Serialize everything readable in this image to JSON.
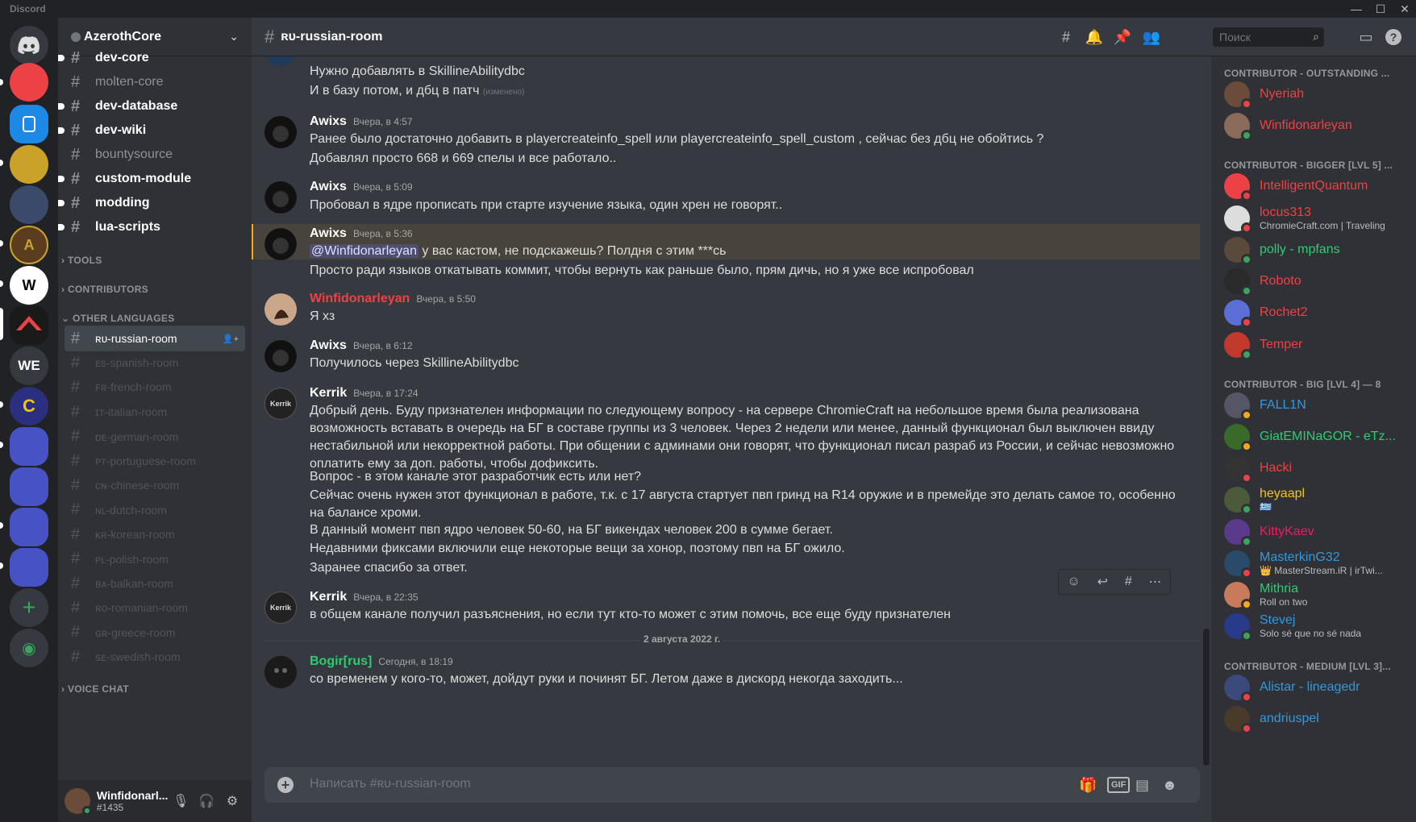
{
  "window": {
    "title": "Discord"
  },
  "guild": {
    "name": "AzerothCore"
  },
  "channel_list": [
    {
      "name": "dev-core",
      "state": "bright",
      "unread": true
    },
    {
      "name": "molten-core",
      "state": "mid",
      "unread": false
    },
    {
      "name": "dev-database",
      "state": "bright",
      "unread": true
    },
    {
      "name": "dev-wiki",
      "state": "bright",
      "unread": true
    },
    {
      "name": "bountysource",
      "state": "mid",
      "unread": false
    },
    {
      "name": "custom-module",
      "state": "bright",
      "unread": true
    },
    {
      "name": "modding",
      "state": "bright",
      "unread": true
    },
    {
      "name": "lua-scripts",
      "state": "bright",
      "unread": true
    }
  ],
  "categories": {
    "tools": "TOOLS",
    "contributors": "CONTRIBUTORS",
    "other_languages": "OTHER LANGUAGES",
    "voice_chat": "VOICE CHAT"
  },
  "language_channels": [
    {
      "name": "ʀᴜ-russian-room",
      "active": true
    },
    {
      "name": "ᴇs-spanish-room"
    },
    {
      "name": "ꜰʀ-french-room"
    },
    {
      "name": "ɪᴛ-italian-room"
    },
    {
      "name": "ᴅᴇ-german-room"
    },
    {
      "name": "ᴘᴛ-portuguese-room"
    },
    {
      "name": "ᴄɴ-chinese-room"
    },
    {
      "name": "ɴʟ-dutch-room"
    },
    {
      "name": "ᴋʀ-korean-room"
    },
    {
      "name": "ᴘʟ-polish-room"
    },
    {
      "name": "ʙᴀ-balkan-room"
    },
    {
      "name": "ʀᴏ-romanian-room"
    },
    {
      "name": "ɢʀ-greece-room"
    },
    {
      "name": "sᴇ-swedish-room"
    }
  ],
  "user": {
    "name": "Winfidonarl...",
    "tag": "#1435"
  },
  "header": {
    "channel": "ʀᴜ-russian-room",
    "search_placeholder": "Поиск"
  },
  "servers": [
    {
      "label": "",
      "color": "#ed4245"
    },
    {
      "label": "",
      "color": "#1e88e5"
    },
    {
      "label": "",
      "color": "#c9a227"
    },
    {
      "label": "",
      "color": "#3b4a6b"
    },
    {
      "label": "",
      "color": "#5a3d1e"
    },
    {
      "label": "W",
      "color": "#ffffff"
    },
    {
      "label": "",
      "color": "#1a1a1a"
    },
    {
      "label": "WE",
      "color": "#36393f"
    },
    {
      "label": "",
      "color": "#2a2f80"
    },
    {
      "label": "",
      "color": "#4752c4"
    },
    {
      "label": "",
      "color": "#4752c4"
    },
    {
      "label": "",
      "color": "#4752c4"
    },
    {
      "label": "",
      "color": "#4752c4"
    }
  ],
  "messages": {
    "m0": {
      "line1": "Нужно добавлять в SkillineAbilitydbc",
      "line2": "И в базу потом, и дбц в патч",
      "edited": "(изменено)"
    },
    "m1": {
      "author": "Awixs",
      "time": "Вчера, в 4:57",
      "line1": "Ранее было достаточно добавить в playercreateinfo_spell или playercreateinfo_spell_custom , сейчас без дбц не обойтись ?",
      "line2": "Добавлял просто 668 и 669 спелы и все работало.."
    },
    "m2": {
      "author": "Awixs",
      "time": "Вчера, в 5:09",
      "line1": "Пробовал в ядре прописать при старте изучение языка, один хрен не говорят.."
    },
    "m3": {
      "author": "Awixs",
      "time": "Вчера, в 5:36",
      "mention": "@Winfidonarleyan",
      "line1": " у вас кастом, не подскажешь? Полдня с этим ***сь",
      "line2": "Просто ради языков откатывать коммит, чтобы вернуть как раньше было, прям дичь, но я уже все испробовал"
    },
    "m4": {
      "author": "Winfidonarleyan",
      "time": "Вчера, в 5:50",
      "line1": "Я хз"
    },
    "m5": {
      "author": "Awixs",
      "time": "Вчера, в 6:12",
      "line1": "Получилось через SkillineAbilitydbc"
    },
    "m6": {
      "author": "Kerrik",
      "time": "Вчера, в 17:24",
      "p1": "Добрый день. Буду признателен информации по следующему вопросу - на сервере ChromieCraft на небольшое время была реализована возможность вставать в очередь на БГ в составе группы из 3 человек. Через 2 недели или менее, данный функционал был выключен ввиду нестабильной или некорректной работы.  При общении с админами они говорят, что функционал писал разраб из России, и сейчас невозможно оплатить ему за доп. работы, чтобы дофиксить.",
      "p2": "Вопрос - в этом канале этот разработчик есть или нет?",
      "p3": "Сейчас очень нужен этот функционал в работе, т.к. с 17 августа стартует пвп гринд на R14 оружие и в премейде это делать самое то, особенно на балансе хроми.",
      "p4": "В данный момент пвп ядро человек 50-60, на БГ викендах человек 200 в сумме бегает.",
      "p5": "Недавними фиксами включили еще некоторые вещи за хонор, поэтому пвп на БГ ожило.",
      "p6": "Заранее спасибо за ответ."
    },
    "m7": {
      "author": "Kerrik",
      "time": "Вчера, в 22:35",
      "line1": "в общем канале получил разъяснения, но если тут кто-то может с этим помочь, все еще буду признателен"
    },
    "date_divider": "2 августа 2022 г.",
    "m8": {
      "author": "Bogir[rus]",
      "time": "Сегодня, в 18:19",
      "line1": "со временем у кого-то, может, дойдут руки и починят БГ. Летом даже в дискорд некогда заходить..."
    }
  },
  "avatar_text": {
    "kerrik": "Kerrik"
  },
  "composer": {
    "placeholder": "Написать #ʀᴜ-russian-room",
    "gif": "GIF"
  },
  "members": {
    "cat1": "CONTRIBUTOR - OUTSTANDING ...",
    "cat2": "CONTRIBUTOR - BIGGER [LVL 5] ...",
    "cat3": "CONTRIBUTOR - BIG [LVL 4] — 8",
    "cat4": "CONTRIBUTOR - MEDIUM [LVL 3]...",
    "list": [
      {
        "name": "Nyeriah",
        "color": "#ed4245",
        "status": "#ed4245"
      },
      {
        "name": "Winfidonarleyan",
        "color": "#ed4245",
        "status": "#3ba55d"
      },
      {
        "name": "IntelligentQuantum",
        "color": "#ed4245",
        "status": "#ed4245"
      },
      {
        "name": "locus313",
        "color": "#ed4245",
        "status": "#ed4245",
        "activity": "ChromieCraft.com | Traveling"
      },
      {
        "name": "polly - mpfans",
        "color": "#2ecc71",
        "status": "#3ba55d"
      },
      {
        "name": "Roboto",
        "color": "#ed4245",
        "status": "#3ba55d"
      },
      {
        "name": "Rochet2",
        "color": "#ed4245",
        "status": "#ed4245"
      },
      {
        "name": "Temper",
        "color": "#ed4245",
        "status": "#3ba55d"
      },
      {
        "name": "FALL1N",
        "color": "#3498db",
        "status": "#faa81a"
      },
      {
        "name": "GiatEMINaGOR - eTz...",
        "color": "#2ecc71",
        "status": "#faa81a"
      },
      {
        "name": "Hacki",
        "color": "#ed4245",
        "status": "#ed4245"
      },
      {
        "name": "heyaapl",
        "color": "#f1c40f",
        "status": "#3ba55d",
        "activity": "🇬🇷"
      },
      {
        "name": "KittyKaev",
        "color": "#e91e63",
        "status": "#3ba55d"
      },
      {
        "name": "MasterkinG32",
        "color": "#3498db",
        "status": "#ed4245",
        "activity": "👑 MasterStream.iR | irTwi..."
      },
      {
        "name": "Mithria",
        "color": "#2ecc71",
        "status": "#faa81a",
        "activity": "Roll on two"
      },
      {
        "name": "Stevej",
        "color": "#3498db",
        "status": "#3ba55d",
        "activity": "Solo sé que no sé nada"
      },
      {
        "name": "Alistar - lineagedr",
        "color": "#3498db",
        "status": "#ed4245"
      },
      {
        "name": "andriuspel",
        "color": "#3498db",
        "status": "#ed4245"
      }
    ]
  }
}
